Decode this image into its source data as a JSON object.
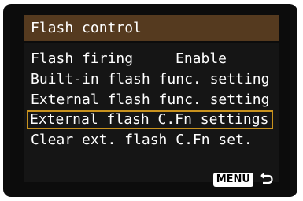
{
  "header": {
    "title": "Flash control"
  },
  "menu": {
    "items": [
      {
        "label": "Flash firing",
        "value": "Enable",
        "selected": false
      },
      {
        "label": "Built-in flash func. setting",
        "selected": false
      },
      {
        "label": "External flash func. setting",
        "selected": false
      },
      {
        "label": "External flash C.Fn settings",
        "selected": true
      },
      {
        "label": "Clear ext. flash C.Fn set.",
        "selected": false
      }
    ]
  },
  "footer": {
    "menu_button_label": "MENU",
    "return_icon": "return-arrow-icon"
  },
  "colors": {
    "header_bg": "#553a1f",
    "selection_border": "#c8921e",
    "background": "#0c0c0c",
    "text": "#ffffff"
  }
}
